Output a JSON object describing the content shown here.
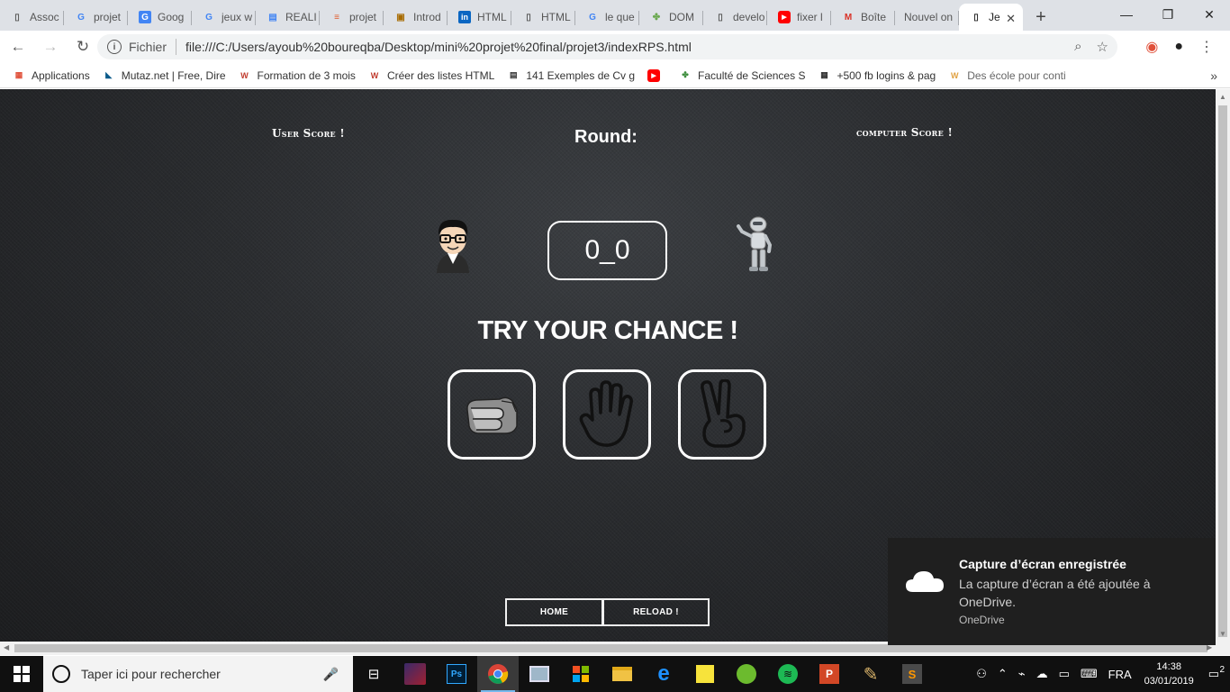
{
  "browser": {
    "tabs": [
      {
        "label": "Assoc",
        "icon": "page-icon"
      },
      {
        "label": "projet",
        "icon": "google-icon"
      },
      {
        "label": "Goog",
        "icon": "google-translate-icon"
      },
      {
        "label": "jeux w",
        "icon": "google-icon"
      },
      {
        "label": "REALI",
        "icon": "docs-icon"
      },
      {
        "label": "projet",
        "icon": "stack-icon"
      },
      {
        "label": "Introd",
        "icon": "spiral-icon"
      },
      {
        "label": "HTML",
        "icon": "linkedin-icon"
      },
      {
        "label": "HTML",
        "icon": "page-icon"
      },
      {
        "label": "le que",
        "icon": "google-icon"
      },
      {
        "label": "DOM",
        "icon": "puzzle-icon"
      },
      {
        "label": "develo",
        "icon": "page-icon"
      },
      {
        "label": "fixer l",
        "icon": "youtube-icon"
      },
      {
        "label": "Boîte",
        "icon": "gmail-icon"
      },
      {
        "label": "Nouvel on",
        "icon": "none"
      },
      {
        "label": "Je",
        "icon": "page-icon",
        "active": true
      }
    ],
    "address": {
      "scheme_label": "Fichier",
      "url": "file:///C:/Users/ayoub%20boureqba/Desktop/mini%20projet%20final/projet3/indexRPS.html"
    },
    "bookmarks": [
      {
        "label": "Applications",
        "icon": "apps-grid-icon"
      },
      {
        "label": "Mutaz.net | Free, Dire",
        "icon": "mutaz-icon"
      },
      {
        "label": "Formation de 3 mois",
        "icon": "w3-icon"
      },
      {
        "label": "Créer des listes HTML",
        "icon": "w3-icon"
      },
      {
        "label": "141 Exemples de Cv g",
        "icon": "doc-icon"
      },
      {
        "label": "",
        "icon": "youtube-icon"
      },
      {
        "label": "Faculté de Sciences S",
        "icon": "faculty-icon"
      },
      {
        "label": "+500 fb logins & pag",
        "icon": "fb-login-icon"
      },
      {
        "label": "Des école pour conti",
        "icon": "school-icon"
      }
    ]
  },
  "game": {
    "user_score_label": "User Score !",
    "round_label": "Round:",
    "computer_score_label": "computer Score !",
    "score": "0_0",
    "prompt": "TRY YOUR CHANCE !",
    "choices": [
      "rock",
      "paper",
      "scissors"
    ],
    "home_label": "HOME",
    "reload_label": "RELOAD !"
  },
  "taskbar": {
    "search_placeholder": "Taper ici pour rechercher",
    "language": "FRA",
    "time": "14:38",
    "date": "03/01/2019",
    "notifications_count": "2"
  },
  "toast": {
    "title": "Capture d’écran enregistrée",
    "body": "La capture d’écran a été ajoutée à OneDrive.",
    "source": "OneDrive"
  }
}
